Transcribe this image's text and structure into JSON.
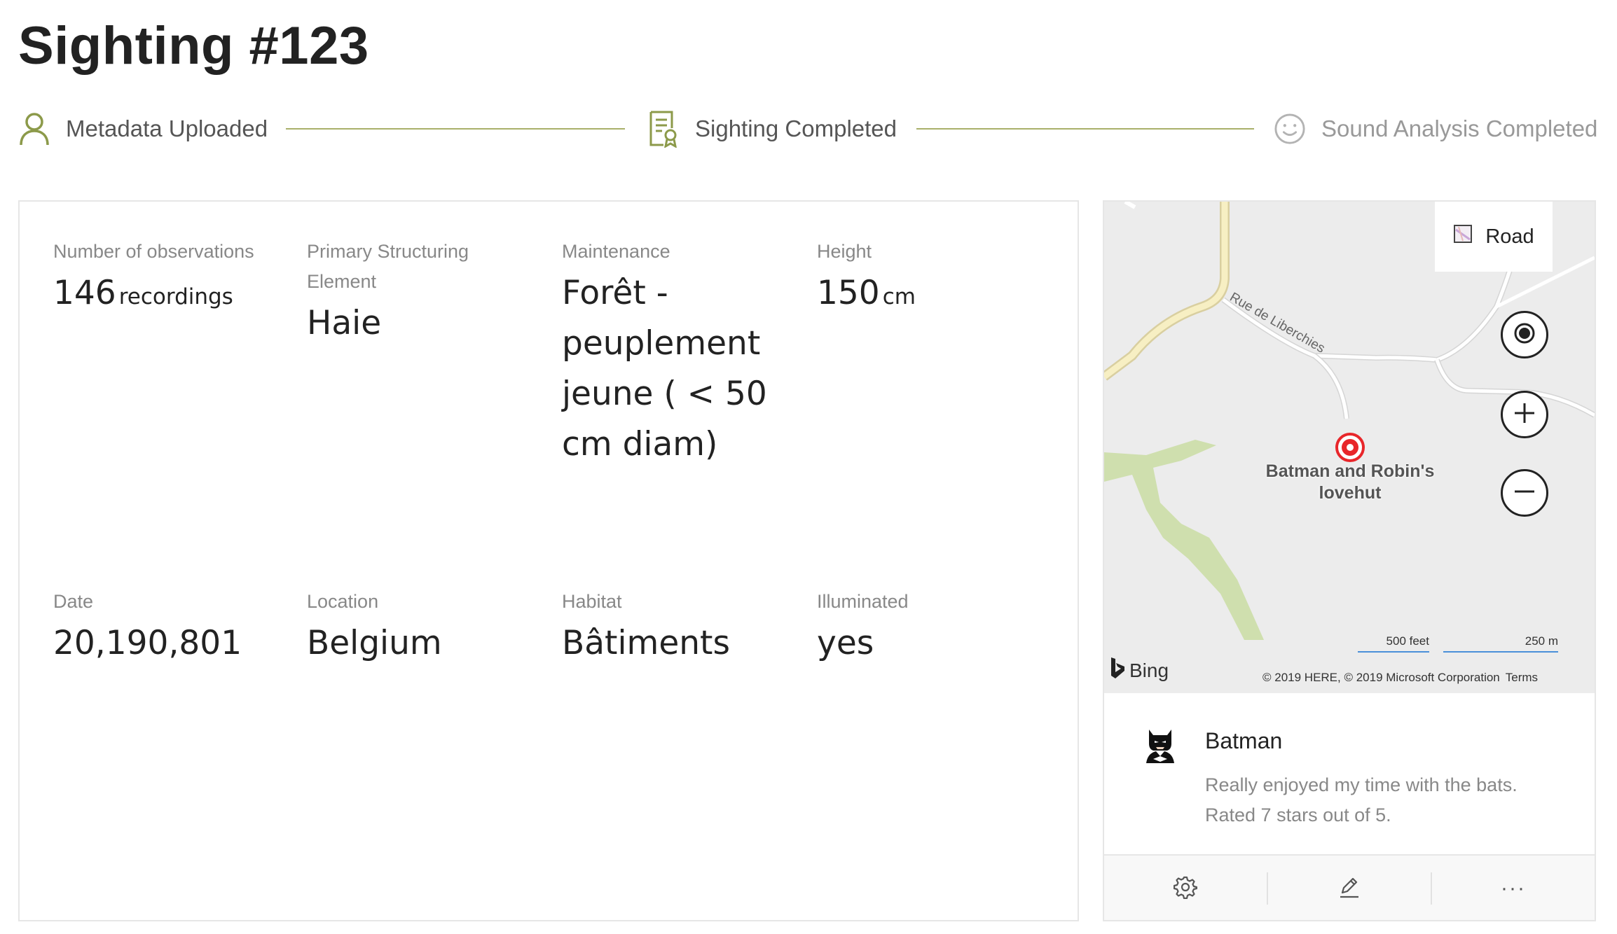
{
  "page": {
    "title": "Sighting #123"
  },
  "stepper": {
    "steps": [
      {
        "label": "Metadata Uploaded",
        "icon": "person-icon",
        "status": "completed"
      },
      {
        "label": "Sighting Completed",
        "icon": "certificate-icon",
        "status": "completed"
      },
      {
        "label": "Sound Analysis Completed",
        "icon": "smiley-icon",
        "status": "pending"
      }
    ],
    "colors": {
      "completed": "#8c9a4a",
      "pending": "#b3b3b3",
      "line": "#a9b06a"
    }
  },
  "details": {
    "observations": {
      "label": "Number of observations",
      "value": "146",
      "unit": "recordings"
    },
    "structuring_element": {
      "label": "Primary Structuring Element",
      "value": "Haie"
    },
    "maintenance": {
      "label": "Maintenance",
      "value": "Forêt - peuplement jeune ( < 50 cm diam)"
    },
    "height": {
      "label": "Height",
      "value": "150",
      "unit": "cm"
    },
    "date": {
      "label": "Date",
      "value": "20,190,801"
    },
    "location": {
      "label": "Location",
      "value": "Belgium"
    },
    "habitat": {
      "label": "Habitat",
      "value": "Bâtiments"
    },
    "illuminated": {
      "label": "Illuminated",
      "value": "yes"
    }
  },
  "map": {
    "style_label": "Road",
    "street_name": "Rue de Liberchies",
    "pin_label": "Batman and Robin's lovehut",
    "scale_imperial": "500 feet",
    "scale_metric": "250 m",
    "brand": "Bing",
    "copyright": "© 2019 HERE, © 2019 Microsoft Corporation",
    "terms_label": "Terms",
    "pin_color": "#e8262a"
  },
  "comment": {
    "author": "Batman",
    "text": "Really enjoyed my time with the bats. Rated 7 stars out of 5."
  },
  "actions": [
    {
      "icon": "gear-icon"
    },
    {
      "icon": "pencil-icon"
    },
    {
      "icon": "more-icon",
      "label": "···"
    }
  ]
}
